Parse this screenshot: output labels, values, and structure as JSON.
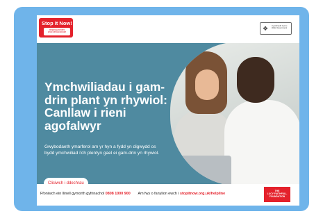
{
  "header": {
    "logo": {
      "title": "Stop It Now!",
      "tagline": "Helping prevent\nchild sexual abuse"
    },
    "gov_logo": {
      "icon": "welsh-dragon-icon",
      "text": "Llywodraeth Cymru\nWelsh Government"
    }
  },
  "hero": {
    "headline": "Ymchwiliadau i gam-drin plant yn rhywiol: Canllaw i rieni agofalwyr",
    "subtext": "Gwybodaeth ymarferol am yr hyn a fydd yn digwydd os bydd ymchwiliad i'ch plentyn gael ei gam-drin yn rhywiol.",
    "cta_label": "Cliciwch i ddechrau",
    "photo": "parents-photo"
  },
  "footer": {
    "helpline_text": "Ffoniwch ein llinell gymorth gyfrinachol",
    "phone": "0808 1000 900",
    "more_info_text": "Am fwy o fanylion ewch i",
    "link": "stopitnow.org.uk/helpline",
    "partner_logo": "THE\nLUCY FAITHFULL\nFOUNDATION"
  },
  "colors": {
    "frame": "#6fb4ea",
    "hero": "#4f8aa0",
    "brand_red": "#e4212b"
  }
}
